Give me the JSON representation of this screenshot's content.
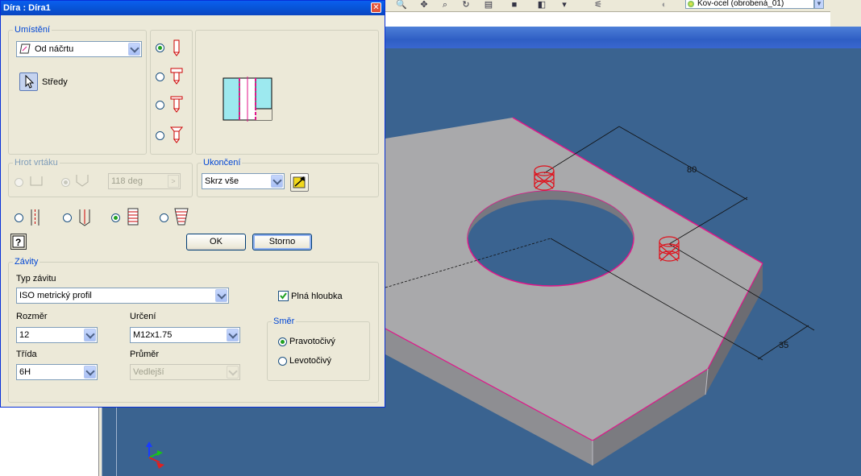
{
  "app": {
    "material": "Kov-ocel (obrobená_01)"
  },
  "dialog": {
    "title": "Díra : Díra1",
    "close_icon": "close-icon",
    "placement": {
      "group_label": "Umístění",
      "placement_type": "Od náčrtu",
      "centers_label": "Středy"
    },
    "drill_point": {
      "group_label": "Hrot vrtáku",
      "angle_value": "118 deg"
    },
    "termination": {
      "group_label": "Ukončení",
      "value": "Skrz vše"
    },
    "buttons": {
      "ok": "OK",
      "cancel": "Storno"
    },
    "threads": {
      "group_label": "Závity",
      "thread_type_label": "Typ závitu",
      "thread_type_value": "ISO metrický profil",
      "full_depth_label": "Plná hloubka",
      "size_label": "Rozměr",
      "size_value": "12",
      "designation_label": "Určení",
      "designation_value": "M12x1.75",
      "class_label": "Třída",
      "class_value": "6H",
      "diameter_label": "Průměr",
      "diameter_value": "Vedlejší",
      "direction": {
        "group_label": "Směr",
        "right_label": "Pravotočivý",
        "left_label": "Levotočivý"
      }
    }
  },
  "viewport": {
    "dimension_80": "80",
    "dimension_35": "35"
  },
  "colors": {
    "titlebar": "#0a5fef",
    "viewport_bg": "#3a6390",
    "part_top": "#a9a9ab",
    "edge_highlight": "#e0168a",
    "hole_marker": "#e0101a"
  }
}
